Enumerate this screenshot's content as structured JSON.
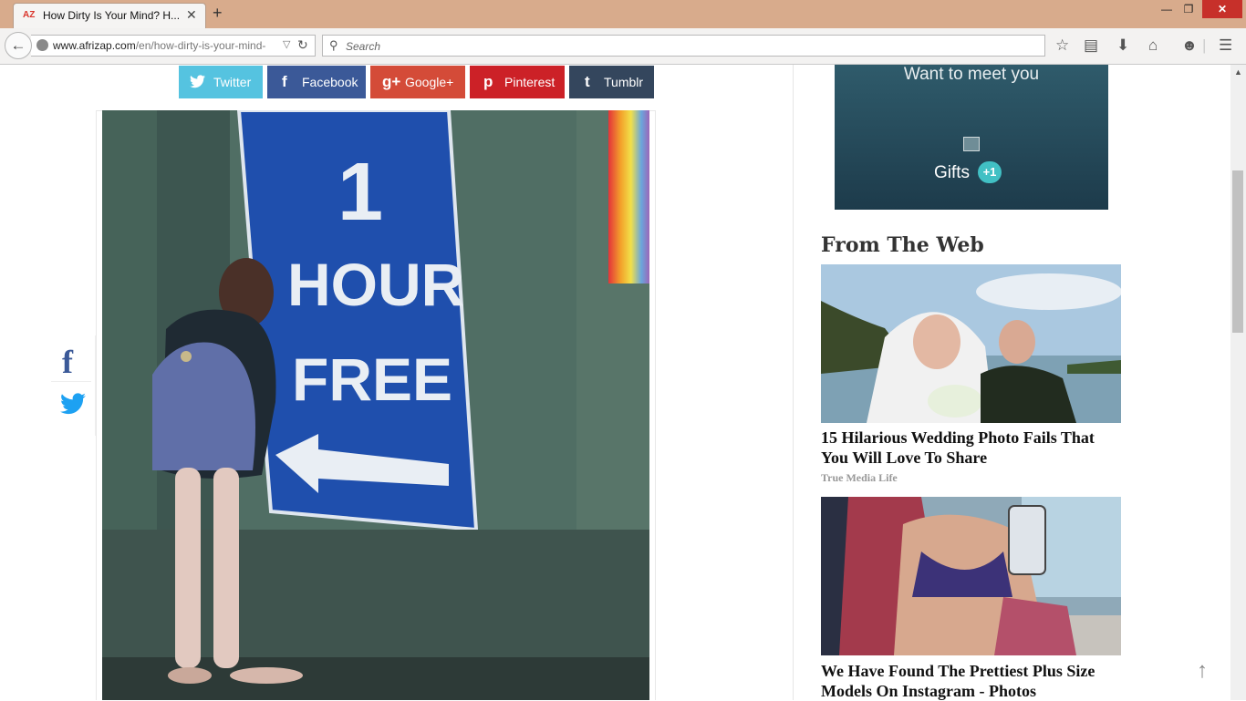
{
  "browser": {
    "tab_title": "How Dirty Is Your Mind? H...",
    "tab_favicon": "AZ",
    "url_domain": "www.afrizap.com",
    "url_path": "/en/how-dirty-is-your-mind-",
    "search_placeholder": "Search",
    "icons": [
      "back-icon",
      "globe-icon",
      "reload-icon",
      "search-icon",
      "bookmark-star-icon",
      "reading-list-icon",
      "download-icon",
      "home-icon",
      "chat-icon",
      "menu-icon"
    ]
  },
  "share_bar": [
    {
      "label": "Twitter",
      "icon": "t-bird",
      "color": "#55c3e0"
    },
    {
      "label": "Facebook",
      "icon": "f",
      "color": "#3b5998"
    },
    {
      "label": "Google+",
      "icon": "g+",
      "color": "#d44b38"
    },
    {
      "label": "Pinterest",
      "icon": "p",
      "color": "#cc2127"
    },
    {
      "label": "Tumblr",
      "icon": "t",
      "color": "#34465d"
    }
  ],
  "floating_share": {
    "facebook": "f"
  },
  "article_image": {
    "sign_number": "1",
    "sign_line1": "HOUR",
    "sign_line2": "FREE"
  },
  "ad": {
    "text": "Want to meet you",
    "gifts_label": "Gifts",
    "gifts_badge": "+1"
  },
  "from_the_web": {
    "heading": "From The Web",
    "items": [
      {
        "title": "15 Hilarious Wedding Photo Fails That You Will Love To Share",
        "source": "True Media Life"
      },
      {
        "title": "We Have Found The Prettiest Plus Size Models On Instagram - Photos",
        "source": ""
      }
    ]
  }
}
